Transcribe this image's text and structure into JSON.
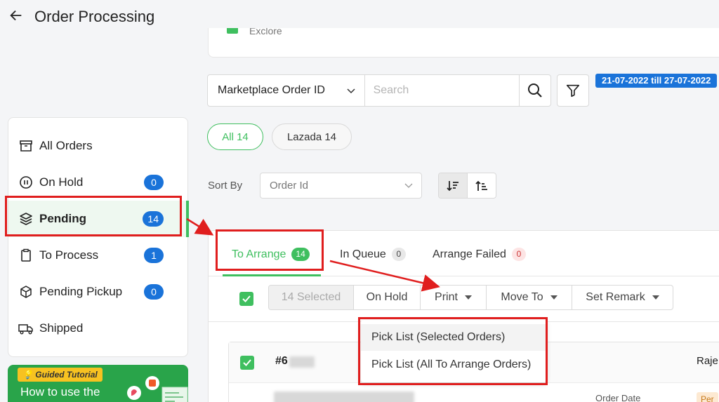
{
  "header": {
    "title": "Order Processing"
  },
  "top_card": {
    "partial_text": "Exclore"
  },
  "search": {
    "field_select": "Marketplace Order ID",
    "placeholder": "Search",
    "date_range": "21-07-2022 till 27-07-2022"
  },
  "marketplace_chips": [
    {
      "label": "All 14",
      "active": true
    },
    {
      "label": "Lazada 14",
      "active": false
    }
  ],
  "sort": {
    "label": "Sort By",
    "value": "Order Id"
  },
  "sidebar": {
    "items": [
      {
        "label": "All Orders",
        "icon": "archive-icon",
        "count": null
      },
      {
        "label": "On Hold",
        "icon": "pause-icon",
        "count": "0"
      },
      {
        "label": "Pending",
        "icon": "layers-icon",
        "count": "14",
        "active": true
      },
      {
        "label": "To Process",
        "icon": "clipboard-icon",
        "count": "1"
      },
      {
        "label": "Pending Pickup",
        "icon": "box-icon",
        "count": "0"
      },
      {
        "label": "Shipped",
        "icon": "truck-icon",
        "count": null
      }
    ]
  },
  "promo": {
    "tag": "Guided Tutorial",
    "text": "How to use the"
  },
  "tabs": [
    {
      "label": "To Arrange",
      "count": "14",
      "active": true
    },
    {
      "label": "In Queue",
      "count": "0"
    },
    {
      "label": "Arrange Failed",
      "count": "0"
    }
  ],
  "actions": {
    "selected": "14 Selected",
    "on_hold": "On Hold",
    "print": "Print",
    "move_to": "Move To",
    "set_remark": "Set Remark"
  },
  "print_menu": [
    {
      "label": "Pick List (Selected Orders)"
    },
    {
      "label": "Pick List (All To Arrange Orders)"
    }
  ],
  "order": {
    "id_prefix": "#6",
    "buyer": "Raje",
    "date_label": "Order Date",
    "status": "Per"
  },
  "colors": {
    "accent_green": "#3fbf5f",
    "count_blue": "#1a73d9",
    "annotation_red": "#e01e1e"
  }
}
